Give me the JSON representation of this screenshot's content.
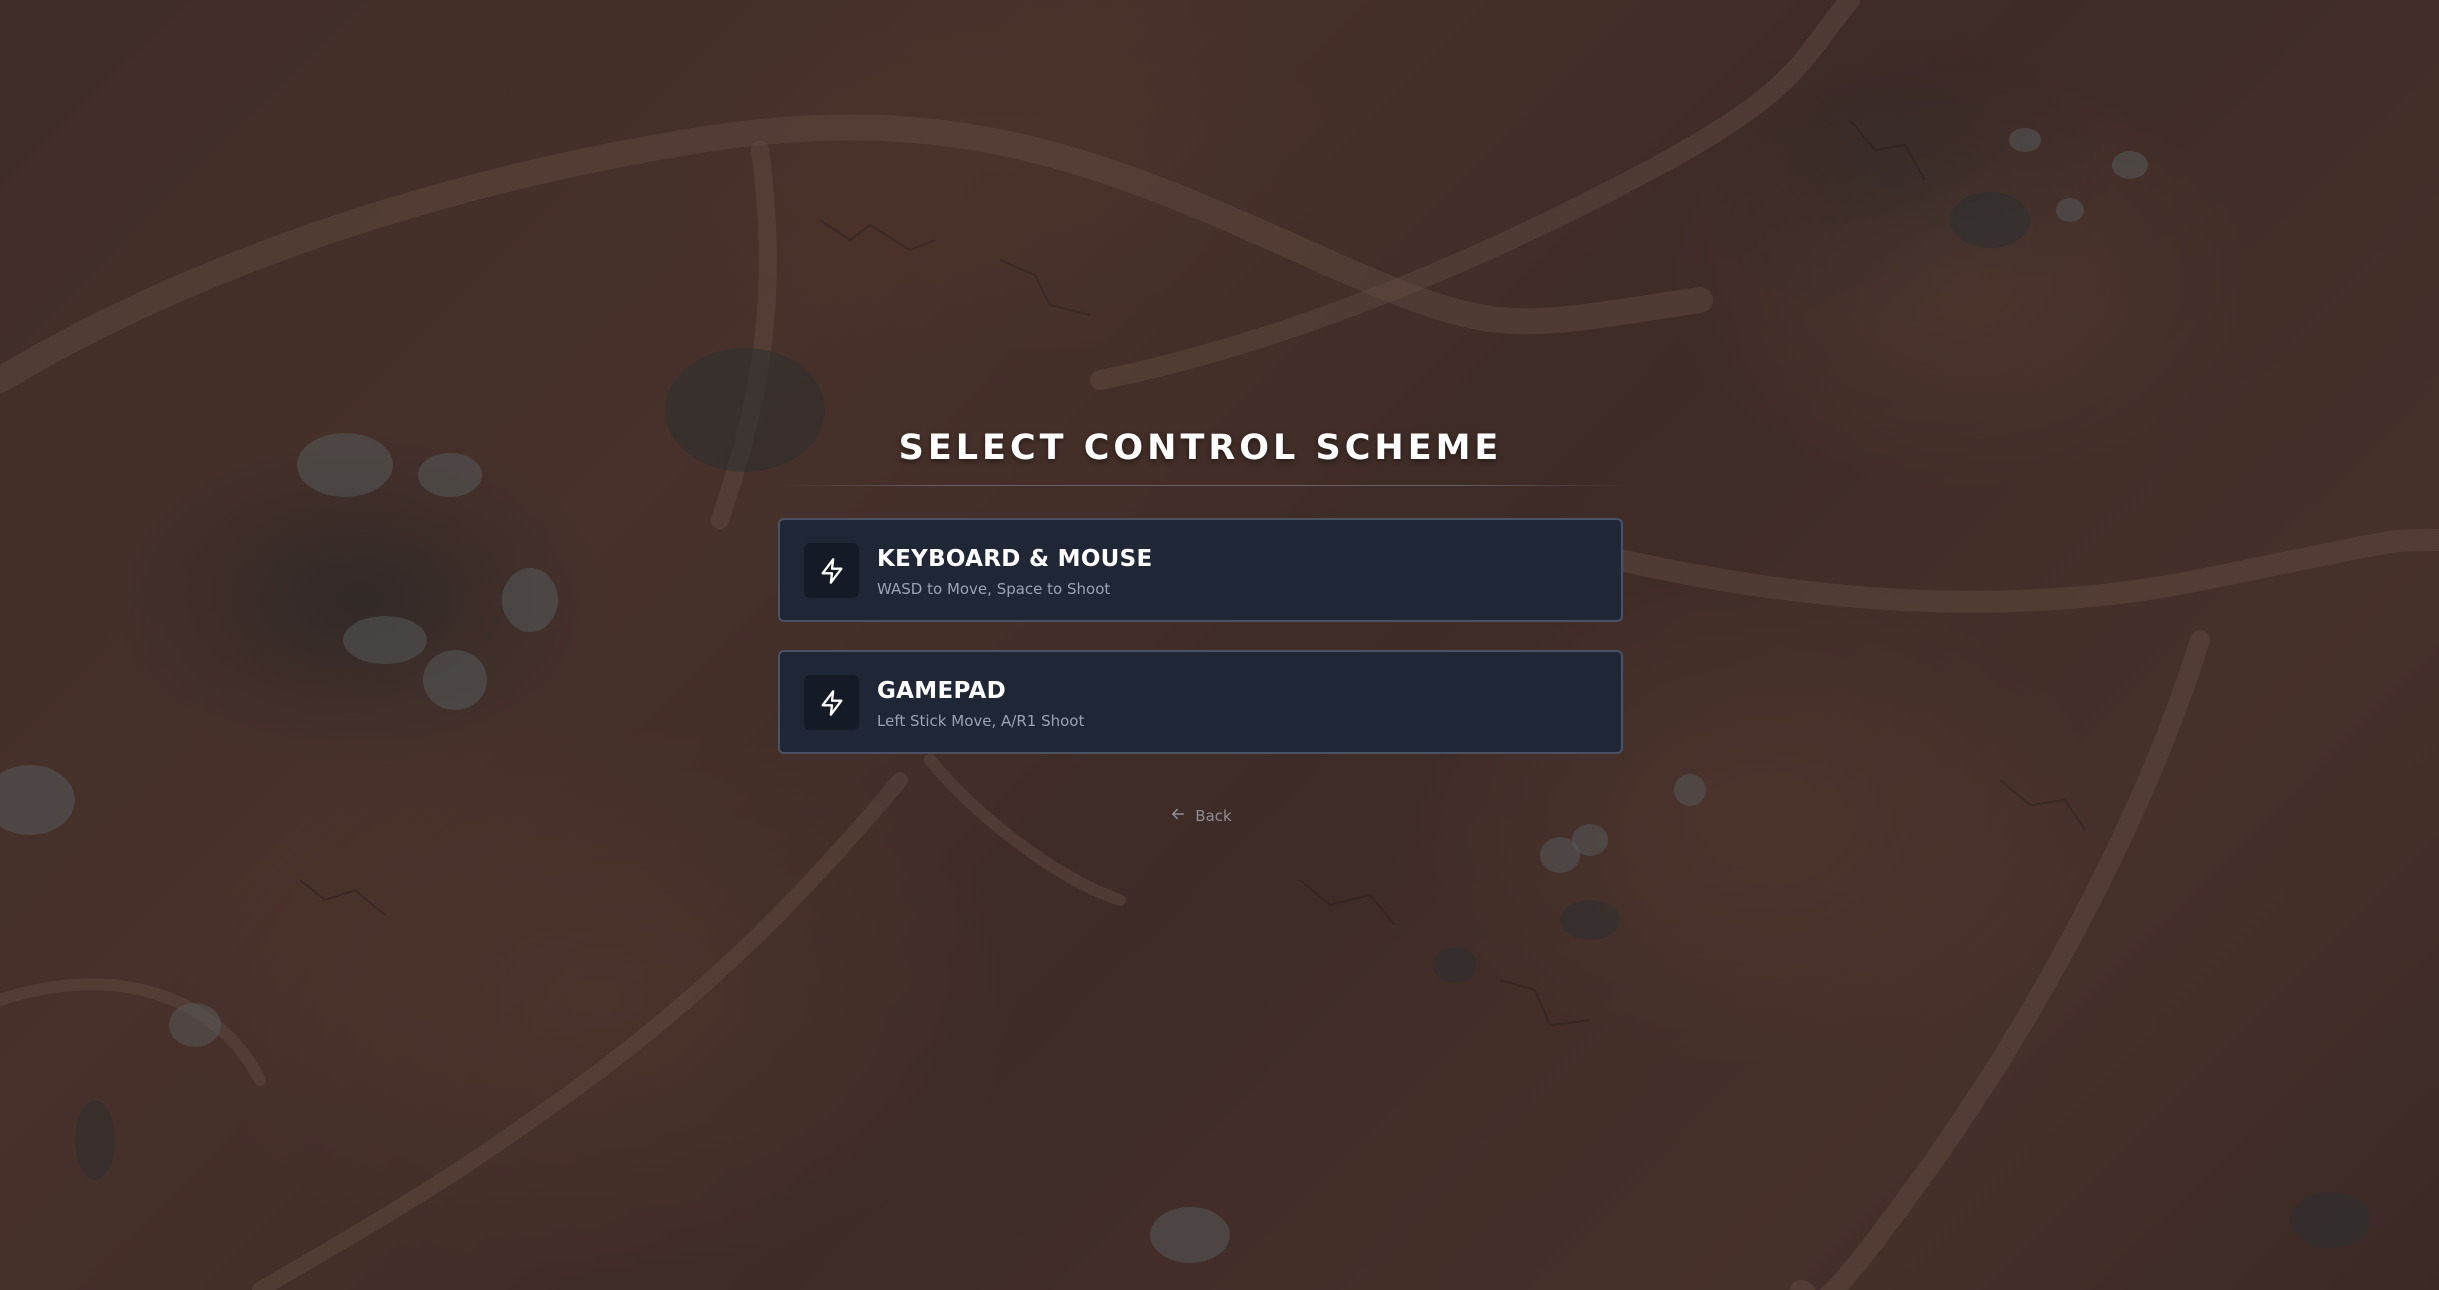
{
  "screen": {
    "title": "SELECT CONTROL SCHEME"
  },
  "options": [
    {
      "label": "KEYBOARD & MOUSE",
      "description": "WASD to Move, Space to Shoot",
      "icon": "lightning-bolt-icon"
    },
    {
      "label": "GAMEPAD",
      "description": "Left Stick Move, A/R1 Shoot",
      "icon": "lightning-bolt-icon"
    }
  ],
  "back": {
    "label": "Back",
    "icon": "arrow-left-icon"
  },
  "colors": {
    "card_background": "#1f2636",
    "card_border": "#4a5266",
    "title": "#ffffff",
    "description": "#9aa3b4",
    "back_text": "#8b8f98"
  }
}
